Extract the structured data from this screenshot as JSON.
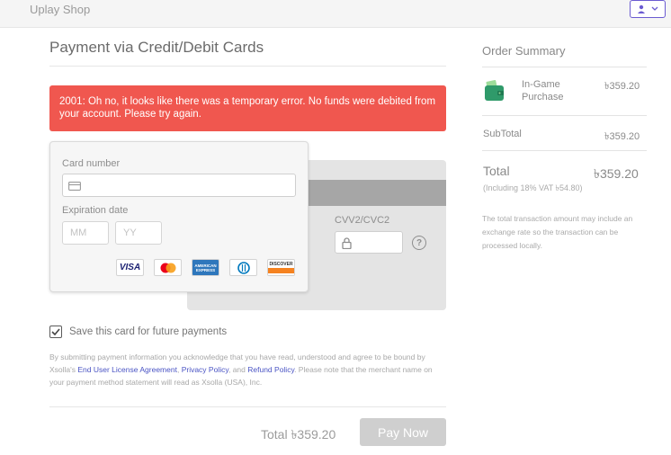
{
  "header": {
    "shop_title": "Uplay Shop"
  },
  "payment": {
    "title": "Payment via Credit/Debit Cards",
    "error": "2001: Oh no, it looks like there was a temporary error. No funds were debited from your account. Please try again.",
    "card_number_label": "Card number",
    "expiration_label": "Expiration date",
    "mm_placeholder": "MM",
    "yy_placeholder": "YY",
    "cvv_label": "CVV2/CVC2",
    "help_glyph": "?",
    "card_logos": [
      "VISA",
      "mastercard",
      "AMERICAN EXPRESS",
      "Diners Club",
      "DISCOVER"
    ],
    "save_card_label": "Save this card for future payments",
    "save_card_checked": true,
    "legal": {
      "part1": "By submitting payment information you acknowledge that you have read, understood and agree to be bound by Xsolla's ",
      "link1": "End User License Agreement",
      "sep1": ", ",
      "link2": "Privacy Policy",
      "sep2": ", and ",
      "link3": "Refund Policy",
      "part2": ". Please note that the merchant name on your payment method statement will read as Xsolla (USA), Inc."
    },
    "total_text": "Total ৳359.20",
    "pay_button": "Pay Now"
  },
  "summary": {
    "title": "Order Summary",
    "item_label_line1": "In-Game",
    "item_label_line2": "Purchase",
    "item_value": "৳359.20",
    "subtotal_label": "SubTotal",
    "subtotal_value": "৳359.20",
    "total_label": "Total",
    "total_value": "৳359.20",
    "vat_text": "(Including 18% VAT ৳54.80)",
    "note": "The total transaction amount may include an exchange rate so the transaction can be processed locally."
  },
  "colors": {
    "accent": "#6b5bd1",
    "error": "#f0574f",
    "icon_green": "#2f9a6a"
  }
}
